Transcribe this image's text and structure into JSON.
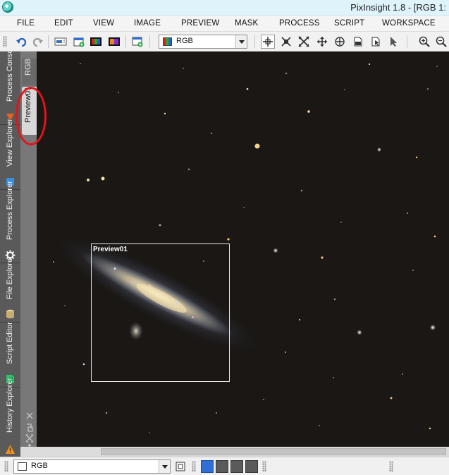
{
  "window": {
    "title": "PixInsight 1.8 - [RGB 1:"
  },
  "menu": [
    "FILE",
    "EDIT",
    "VIEW",
    "IMAGE",
    "PREVIEW",
    "MASK",
    "PROCESS",
    "SCRIPT",
    "WORKSPACE"
  ],
  "toolbar": {
    "icons": [
      "undo-icon",
      "redo-icon",
      "view-identifier-icon",
      "new-image-icon",
      "rgb-channels-icon",
      "channel-extract-icon",
      "new-preview-icon",
      "zoom-in-icon",
      "zoom-out-icon"
    ],
    "view_selector": {
      "value": "RGB"
    },
    "mode_icons": [
      "readout-mode-icon",
      "zoom-mode-icon",
      "pan-mode-icon",
      "fit-mode-icon",
      "center-mode-icon",
      "edit-preview-mode-icon",
      "new-preview-mode-icon",
      "select-mode-icon"
    ]
  },
  "left_dock": {
    "tabs": [
      {
        "label": "Process Console",
        "icon": "process-console-icon",
        "color": "#e9621e"
      },
      {
        "label": "View Explorer",
        "icon": "view-explorer-icon",
        "color": "#3b8fe0"
      },
      {
        "label": "Process Explorer",
        "icon": "gear-icon",
        "color": "#ffffff"
      },
      {
        "label": "File Explorer",
        "icon": "drive-icon",
        "color": "#d8c08a"
      },
      {
        "label": "Script Editor",
        "icon": "script-icon",
        "color": "#27c166"
      },
      {
        "label": "History Explorer",
        "icon": "history-icon",
        "color": "#f2901e"
      }
    ]
  },
  "image_window": {
    "view_tabs": [
      "RGB",
      "Preview01"
    ],
    "active_view_tab": "Preview01",
    "preview_label": "Preview01"
  },
  "status_bar": {
    "view_selector": {
      "value": "RGB"
    },
    "swatch_colors": [
      "#2f6fd6",
      "#5a5a5a",
      "#5a5a5a",
      "#5a5a5a"
    ]
  },
  "colors": {
    "accent_red": "#e1141b",
    "dock_bg": "#5a5a5a",
    "image_bg": "#1a1715"
  }
}
